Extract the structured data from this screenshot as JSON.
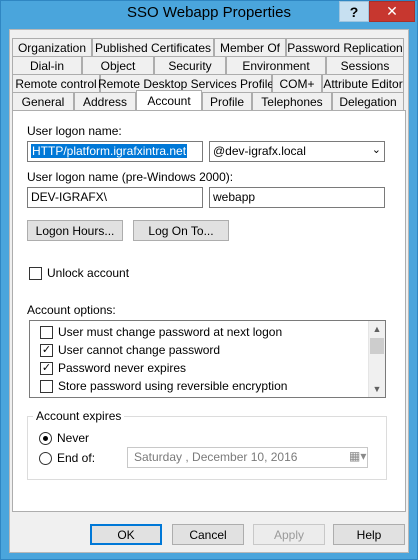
{
  "window": {
    "title": "SSO Webapp Properties",
    "help_glyph": "?",
    "close_glyph": "✕"
  },
  "tabs": {
    "row1": [
      "Organization",
      "Published Certificates",
      "Member Of",
      "Password Replication"
    ],
    "row2": [
      "Dial-in",
      "Object",
      "Security",
      "Environment",
      "Sessions"
    ],
    "row3": [
      "Remote control",
      "Remote Desktop Services Profile",
      "COM+",
      "Attribute Editor"
    ],
    "row4": [
      "General",
      "Address",
      "Account",
      "Profile",
      "Telephones",
      "Delegation"
    ],
    "active": "Account"
  },
  "account": {
    "logon_name_label": "User logon name:",
    "logon_name_value": "HTTP/platform.igrafxintra.net",
    "domain_suffix": "@dev-igrafx.local",
    "pre2000_label": "User logon name (pre-Windows 2000):",
    "pre2000_domain": "DEV-IGRAFX\\",
    "pre2000_user": "webapp",
    "logon_hours_button": "Logon Hours...",
    "logon_to_button": "Log On To...",
    "unlock_label": "Unlock account",
    "options_label": "Account options:",
    "options": [
      {
        "label": "User must change password at next logon",
        "checked": false
      },
      {
        "label": "User cannot change password",
        "checked": true
      },
      {
        "label": "Password never expires",
        "checked": true
      },
      {
        "label": "Store password using reversible encryption",
        "checked": false
      }
    ],
    "expires_label": "Account expires",
    "never_label": "Never",
    "end_of_label": "End of:",
    "expires_selection": "never",
    "end_date": "Saturday   , December 10, 2016"
  },
  "footer": {
    "ok": "OK",
    "cancel": "Cancel",
    "apply": "Apply",
    "help": "Help"
  }
}
